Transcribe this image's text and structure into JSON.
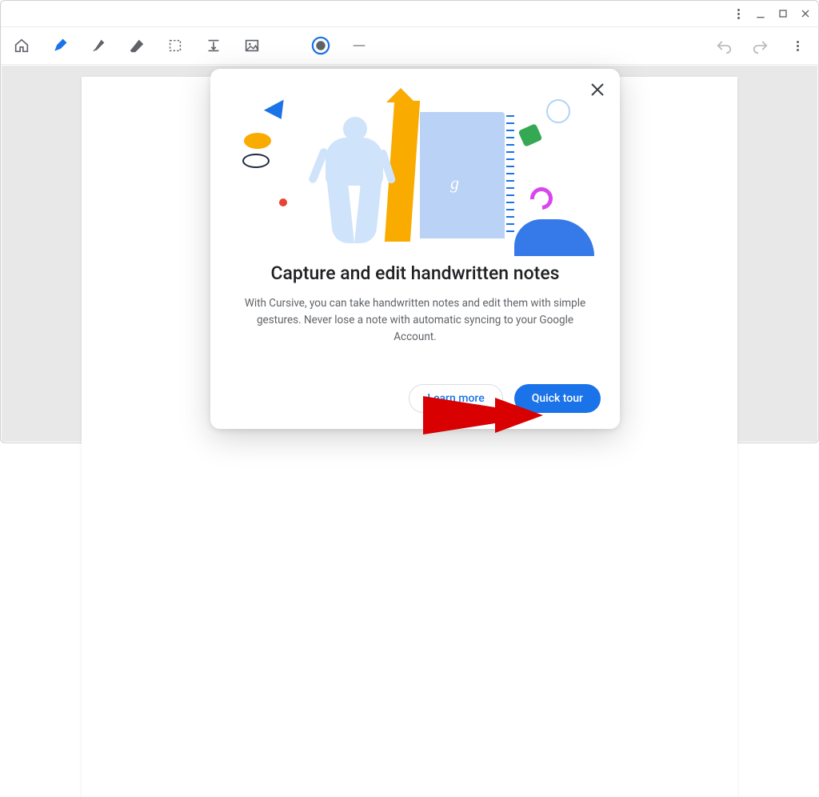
{
  "titlebar": {
    "menu": "More",
    "minimize": "Minimize",
    "maximize": "Maximize",
    "close": "Close"
  },
  "toolbar": {
    "home": "Home",
    "pen": "Pen",
    "highlighter": "Highlighter",
    "eraser": "Eraser",
    "select": "Selection",
    "insert": "Insert space",
    "image": "Image",
    "color": "Stroke color",
    "stroke": "Stroke width",
    "undo": "Undo",
    "redo": "Redo",
    "menu": "More options"
  },
  "dialog": {
    "title": "Capture and edit handwritten notes",
    "body": "With Cursive, you can take handwritten notes and edit them with simple gestures. Never lose a note with automatic syncing to your Google Account.",
    "learn_more": "Learn more",
    "quick_tour": "Quick tour",
    "close_label": "Close"
  },
  "colors": {
    "accent": "#1a73e8",
    "text": "#202124",
    "muted": "#5f6368",
    "canvas_bg": "#e8e8e8",
    "arrow": "#d80000"
  }
}
